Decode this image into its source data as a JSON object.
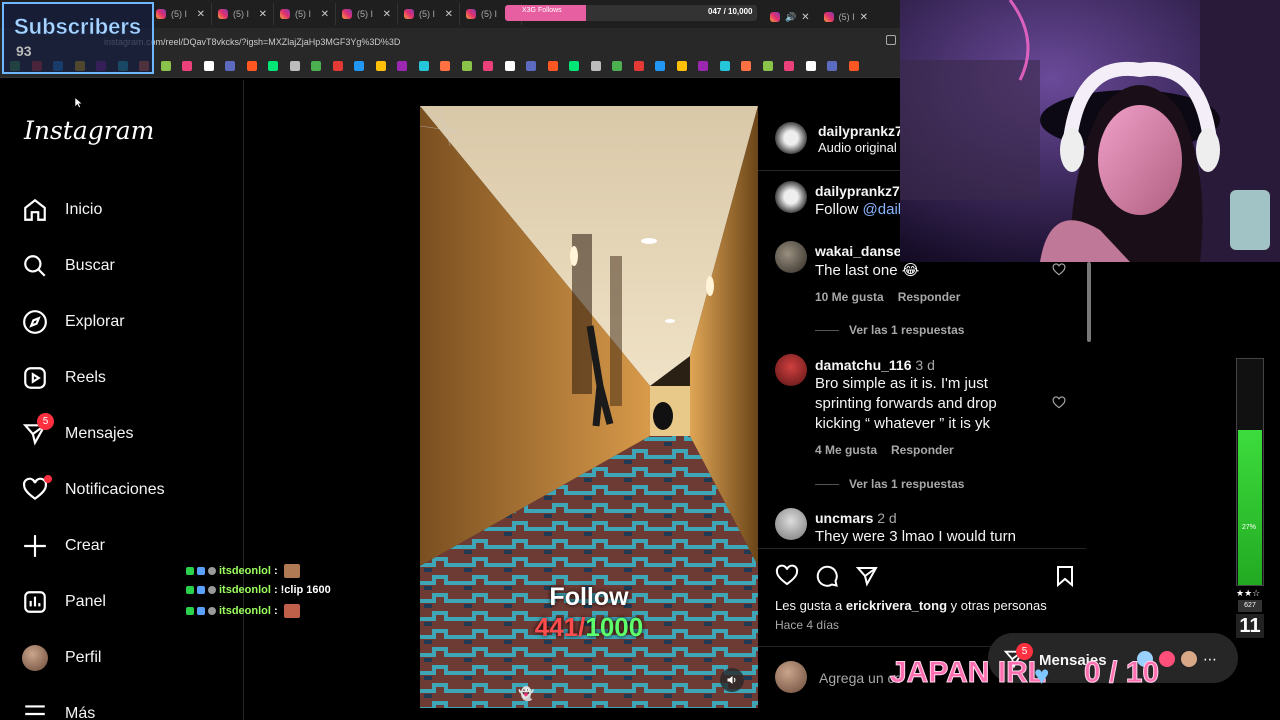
{
  "browser": {
    "tab_labels": [
      "(5) I",
      "(5) I",
      "(5) I",
      "(5) I",
      "(5) I",
      "(5) I",
      "(5) I",
      "(5) I",
      "(5) I"
    ],
    "url": "instagram.com/reel/DQavT8vkcks/?igsh=MXZlajZjaHp3MGF3Yg%3D%3D",
    "follow_goal": {
      "label": "X3G Follows",
      "value_text": "047 / 10,000",
      "progress": 0.0047
    }
  },
  "overlay": {
    "subscribers_title": "Subscribers",
    "subscribers_count": "93",
    "japan_irl": "JAPAN IRL",
    "heart_count": "0 / 10",
    "meter_pct": "27%",
    "meter_level": 0.68,
    "badge_627": "627",
    "badge_11": "11",
    "stars": "★★☆"
  },
  "sidebar": {
    "logo": "Instagram",
    "items": [
      {
        "label": "Inicio",
        "icon": "home-icon"
      },
      {
        "label": "Buscar",
        "icon": "search-icon"
      },
      {
        "label": "Explorar",
        "icon": "compass-icon"
      },
      {
        "label": "Reels",
        "icon": "reels-icon"
      },
      {
        "label": "Mensajes",
        "icon": "messenger-icon",
        "badge": "5"
      },
      {
        "label": "Notificaciones",
        "icon": "heart-icon"
      },
      {
        "label": "Crear",
        "icon": "plus-icon"
      },
      {
        "label": "Panel",
        "icon": "chart-icon"
      },
      {
        "label": "Perfil",
        "icon": "avatar"
      },
      {
        "label": "Más",
        "icon": "menu-icon"
      }
    ]
  },
  "chat": [
    {
      "user": "itsdeonlol",
      "sep": ":",
      "message": ""
    },
    {
      "user": "itsdeonlol",
      "sep": ":",
      "message": "!clip 1600"
    },
    {
      "user": "itsdeonlol",
      "sep": ":",
      "message": ""
    }
  ],
  "video": {
    "follow_text": "Follow",
    "count_current": "441",
    "count_sep": "/",
    "count_goal": "1000"
  },
  "post": {
    "author": "dailyprankz7",
    "audio": "Audio original",
    "caption_user": "dailyprankz7",
    "caption_text": "Follow",
    "caption_mention": "@daily",
    "comments": [
      {
        "user": "wakai_dansei_",
        "time": "",
        "text": "The last one 😂",
        "likes": "10 Me gusta",
        "reply": "Responder",
        "replies": "Ver las 1 respuestas"
      },
      {
        "user": "damatchu_116",
        "time": "3 d",
        "text": "Bro simple as it is. I'm just sprinting forwards and drop kicking “ whatever ” it is yk",
        "likes": "4 Me gusta",
        "reply": "Responder",
        "replies": "Ver las 1 respuestas"
      },
      {
        "user": "uncmars",
        "time": "2 d",
        "text": "They were 3 lmao I would turn",
        "likes": "",
        "reply": "",
        "replies": ""
      }
    ],
    "likes_prefix": "Les gusta a",
    "likes_user": "erickrivera_tong",
    "likes_suffix": "y otras personas",
    "age": "Hace 4 días",
    "add_comment_placeholder": "Agrega un co"
  },
  "messages_pill": {
    "label": "Mensajes",
    "badge": "5"
  },
  "colors": {
    "accent_red": "#ff3040",
    "counter_red": "#ff4d4d",
    "counter_green": "#5dff6a",
    "japan_pink": "#ff6fb0"
  }
}
